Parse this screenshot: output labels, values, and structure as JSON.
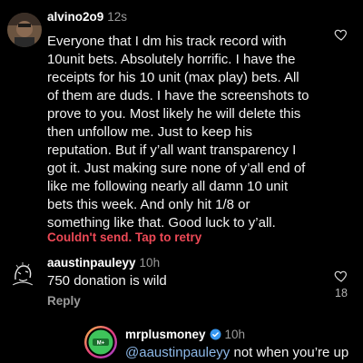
{
  "comments": [
    {
      "username": "alvino2o9",
      "time": "12s",
      "lines": [
        "Everyone that I dm his track record with",
        "10unit bets. Absolutely horrific. I have the",
        "receipts for his 10 unit (max play) bets. All",
        "of them are duds. I have the screenshots to",
        "prove to you.  Most likely he will delete this",
        "then unfollow me. Just to keep his",
        "reputation. But if y’all want transparency I",
        "got it. Just making sure none of y’all end of",
        "like me following nearly all damn 10 unit",
        "bets this week. And only hit 1/8 or",
        "something like that. Good luck to y’all."
      ],
      "status": "Couldn't send. Tap to retry",
      "avatar_icon": "profile-photo-icon"
    },
    {
      "username": "aaustinpauleyy",
      "time": "10h",
      "text": "750 donation is wild",
      "reply_label": "Reply",
      "likes": "18",
      "avatar_icon": "sketch-avatar-icon"
    },
    {
      "username": "mrplusmoney",
      "time": "10h",
      "mention": "@aaustinpauleyy",
      "text_after_mention": " not when you’re up",
      "verified_icon": "verified-badge-icon",
      "avatar_icon": "logo-avatar-icon"
    }
  ],
  "colors": {
    "background": "#000000",
    "error": "#ed4956",
    "mention": "#8db8e8",
    "verified": "#3897f0",
    "muted": "#9a9a9a"
  }
}
